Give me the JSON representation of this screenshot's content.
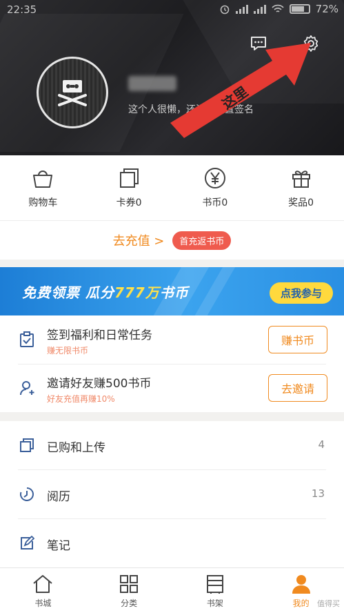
{
  "status_bar": {
    "time": "22:35",
    "battery": "72%"
  },
  "profile": {
    "signature": "这个人很懒，还没有设置签名",
    "arrow_label": "这里"
  },
  "quick_actions": [
    {
      "label": "购物车",
      "icon": "cart-basket-icon"
    },
    {
      "label": "卡券0",
      "icon": "coupon-icon"
    },
    {
      "label": "书币0",
      "icon": "yen-coin-icon"
    },
    {
      "label": "奖品0",
      "icon": "gift-icon"
    }
  ],
  "recharge": {
    "link": "去充值 >",
    "badge": "首充返书币"
  },
  "banner": {
    "text_a": "免费领票  瓜分",
    "text_hi": "777万",
    "text_b": "书币",
    "cta": "点我参与"
  },
  "tasks": [
    {
      "title": "签到福利和日常任务",
      "subtitle": "赚无限书币",
      "button": "赚书币",
      "icon": "checkin-clipboard-icon"
    },
    {
      "title": "邀请好友赚500书币",
      "subtitle": "好友充值再赚10%",
      "button": "去邀请",
      "icon": "add-friend-icon"
    }
  ],
  "menu": [
    {
      "label": "已购和上传",
      "count": "4",
      "icon": "purchased-icon"
    },
    {
      "label": "阅历",
      "count": "13",
      "icon": "history-icon"
    },
    {
      "label": "笔记",
      "count": "",
      "icon": "note-icon"
    }
  ],
  "bottom_nav": [
    {
      "label": "书城",
      "icon": "home-icon"
    },
    {
      "label": "分类",
      "icon": "category-grid-icon"
    },
    {
      "label": "书架",
      "icon": "bookshelf-icon"
    },
    {
      "label": "我的",
      "icon": "person-icon"
    }
  ],
  "watermark": "值得买",
  "colors": {
    "accent": "#f08a1f",
    "badge": "#ef5b4e",
    "banner": "#2a8fe3",
    "header_bg": "#1d1d20"
  }
}
